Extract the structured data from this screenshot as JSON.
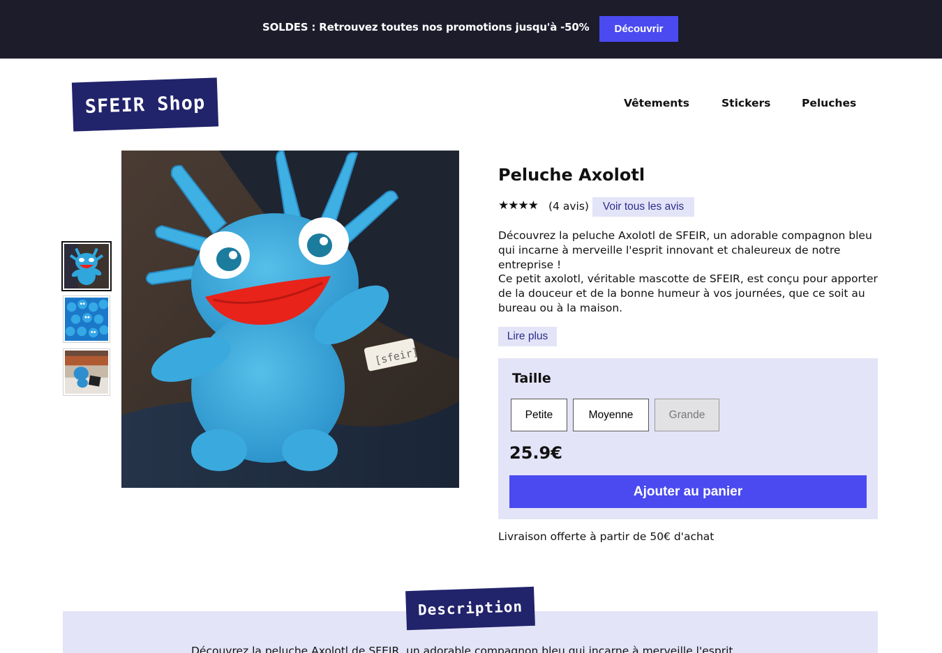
{
  "promo": {
    "text": "SOLDES : Retrouvez toutes nos promotions jusqu'à -50%",
    "button_label": "Découvrir"
  },
  "header": {
    "logo": "SFEIR Shop",
    "nav": [
      "Vêtements",
      "Stickers",
      "Peluches"
    ]
  },
  "gallery": {
    "thumbnails": [
      "axolotl-plush-photo",
      "axolotl-plush-pile-photo",
      "axolotl-plush-desk-photo"
    ],
    "active_index": 0
  },
  "product": {
    "title": "Peluche Axolotl",
    "rating_stars": "★★★★",
    "rating": 4,
    "review_count": "(4 avis)",
    "see_reviews_label": "Voir tous les avis",
    "description_p1": "Découvrez la peluche Axolotl de SFEIR, un adorable compagnon bleu qui incarne à merveille l'esprit innovant et chaleureux de notre entreprise !",
    "description_p2": "Ce petit axolotl, véritable mascotte de SFEIR, est conçu pour apporter de la douceur et de la bonne humeur à vos journées, que ce soit au bureau ou à la maison.",
    "read_more_label": "Lire plus",
    "size_label": "Taille",
    "sizes": [
      {
        "label": "Petite",
        "available": true
      },
      {
        "label": "Moyenne",
        "available": true
      },
      {
        "label": "Grande",
        "available": false
      }
    ],
    "price": "25.9€",
    "add_to_cart_label": "Ajouter au panier",
    "shipping_note": "Livraison offerte à partir de 50€ d'achat"
  },
  "description_section": {
    "heading": "Description",
    "text": "Découvrez la peluche Axolotl de SFEIR, un adorable compagnon bleu qui incarne à merveille l'esprit"
  },
  "colors": {
    "promo_bg": "#1c1c2b",
    "accent": "#4a4af0",
    "brand_navy": "#21236b",
    "lavender": "#e4e4f8"
  }
}
